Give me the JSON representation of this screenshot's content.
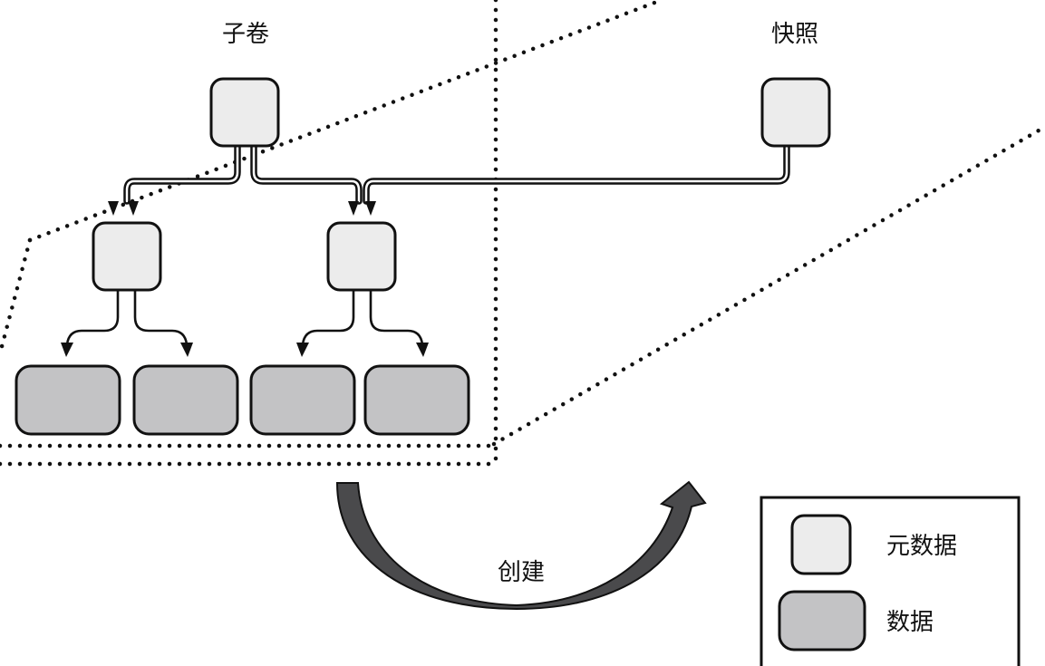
{
  "subvolume": {
    "label": "子卷"
  },
  "snapshot": {
    "label": "快照"
  },
  "action": {
    "label": "创建"
  },
  "legend": {
    "metadata_label": "元数据",
    "data_label": "数据"
  },
  "colors": {
    "metadata_fill": "#ececec",
    "data_fill": "#c3c3c5",
    "outline": "#111111",
    "arrow_fill": "#4a4a4c"
  }
}
